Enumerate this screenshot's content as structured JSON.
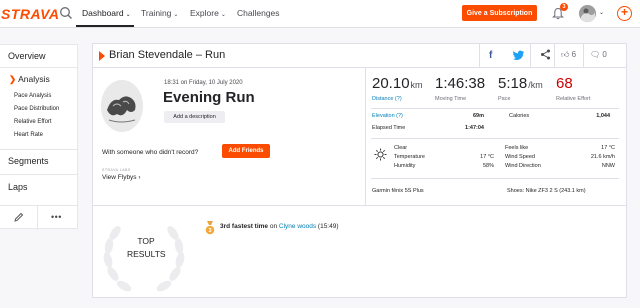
{
  "nav": {
    "logo": "STRAVA",
    "items": [
      {
        "label": "Dashboard",
        "active": true
      },
      {
        "label": "Training"
      },
      {
        "label": "Explore"
      },
      {
        "label": "Challenges"
      }
    ],
    "subscribe_label": "Give a Subscription",
    "notification_count": "3",
    "accent_color": "#fc4c02"
  },
  "sidebar": {
    "overview": "Overview",
    "analysis": "Analysis",
    "analysis_items": [
      "Pace Analysis",
      "Pace Distribution",
      "Relative Effort",
      "Heart Rate"
    ],
    "segments": "Segments",
    "laps": "Laps",
    "tools": [
      "pencil-icon",
      "more-icon"
    ]
  },
  "activity": {
    "header_title": "Brian Stevendale – Run",
    "kudos_count": "6",
    "comment_count": "0",
    "date": "18:31 on Friday, 10 July 2020",
    "name": "Evening Run",
    "add_description": "Add a description",
    "record_question": "With someone who didn't record?",
    "add_friends": "Add Friends",
    "labs_label": "STRAVA LABS",
    "flybys": "View Flybys",
    "stats": {
      "distance": {
        "value": "20.10",
        "unit": "km",
        "label": "Distance (?)"
      },
      "moving_time": {
        "value": "1:46:38",
        "label": "Moving Time"
      },
      "pace": {
        "value": "5:18",
        "unit": "/km",
        "label": "Pace"
      },
      "relative_effort": {
        "value": "68",
        "label": "Relative Effort"
      }
    },
    "elevation_label": "Elevation (?)",
    "elevation_value": "69m",
    "calories_label": "Calories",
    "calories_value": "1,044",
    "elapsed_label": "Elapsed Time",
    "elapsed_value": "1:47:04",
    "weather": {
      "condition_label": "Clear",
      "temperature_label": "Temperature",
      "temperature_value": "17 °C",
      "humidity_label": "Humidity",
      "humidity_value": "58%",
      "feels_like_label": "Feels like",
      "feels_like_value": "17 °C",
      "wind_speed_label": "Wind Speed",
      "wind_speed_value": "21.6 km/h",
      "wind_direction_label": "Wind Direction",
      "wind_direction_value": "NNW"
    },
    "device": "Garmin fēnix 5S Plus",
    "shoes": "Shoes: Nike ZF3 2 S (243.1 km)"
  },
  "results": {
    "badge_line1": "TOP",
    "badge_line2": "RESULTS",
    "achievement_bold": "3rd fastest time",
    "achievement_on": " on ",
    "segment": "Clyne woods",
    "time": " (15:49)"
  }
}
